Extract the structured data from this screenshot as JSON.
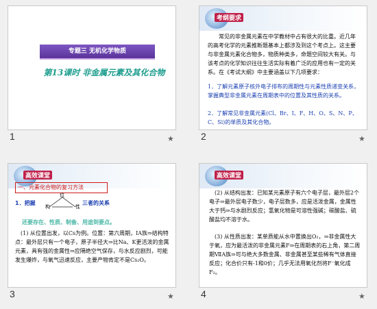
{
  "slides": [
    {
      "number": "1",
      "title_box": "专题三  无机化学物质",
      "lesson_title": "第13课时  非金属元素及其化合物"
    },
    {
      "number": "2",
      "badge": "考纲要求",
      "intro": "常见的非金属元素在中学教材中占有很大的比重。近几年的高考化学的元素推断题基本上都涉及到这个考点上。这主要与非金属元素化合物多，物质种类多，命题空间较大有关。与该考点的化学知识往往生活实际有着广泛的应用也有一定的关系。在《考试大纲》中主要涵盖以下几项要求：",
      "req1": "1．了解元素原子核外电子排布的周期性与元素性质递变关系，掌握典型非金属元素在周期表中的位置及其性质的关系。",
      "req2": "2．了解常见非金属元素(Cl、Br、I、F、H、O、S、N、P、C、Si)的单质及其化合物。"
    },
    {
      "number": "3",
      "badge": "高效课堂",
      "box_title": "一、元素化合物的复习方法",
      "point1_prefix": "1．把握",
      "point1_suffix": "三者的关系",
      "tri_top": "位",
      "tri_left": "构",
      "tri_right": "性",
      "highlight": "还要存在、性质、制备、用途到要点。",
      "para": "(1) 从位置出发，以Cs为例。位置：第六周期，ⅠA族⇒结构特点：最外层只有一个电子，原子半径大⇒比Na、K更活泼的金属元素，具有强的金属性⇒应隔绝空气保存，与水反应剧烈，可能发生爆炸，与氧气迅速反应，主要产物肯定不是Cs₂O。"
    },
    {
      "number": "4",
      "badge": "高效课堂",
      "para1": "(2) 从结构出发：已知某元素原子有六个电子层，最外层2个电子⇒最外层电子数少，电子层数多，应是活泼金属，金属性大于钙⇒与水剧烈反应；氢氧化物是可溶性强碱；碳酸盐、硫酸盐均不溶于水。",
      "para2": "(3) 从性质出发：某单质能从水中置换出O₂，⇒非金属性大于氧，应为最活泼的非金属元素F⇒在周期表的右上角，第二周期ⅦA族⇒可与绝大多数金属、非金属甚至某些稀有气体直接反应；化合价只有-1和0价；几乎无法用氧化剂将F⁻氧化成F₂。"
    }
  ],
  "icons": {
    "star": "★"
  },
  "colors": {
    "purple": "#6a3fa8",
    "teal": "#1f9e8f",
    "red": "#d01818",
    "blue": "#1a3fb0"
  }
}
